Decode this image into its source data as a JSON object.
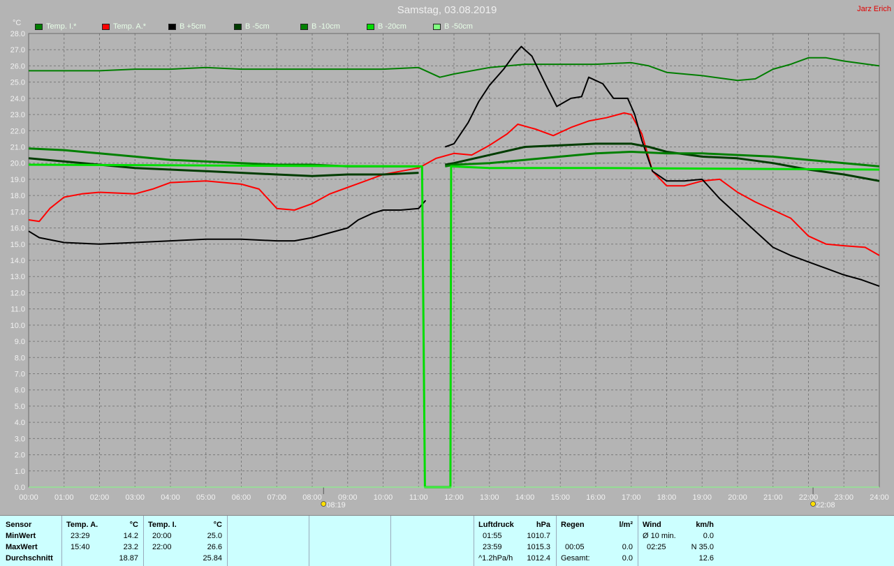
{
  "header": {
    "title": "Samstag, 03.08.2019",
    "author": "Jarz Erich"
  },
  "chart_data": {
    "type": "line",
    "ylabel": "°C",
    "ylim": [
      0,
      28
    ],
    "yticks": [
      "0.0",
      "1.0",
      "2.0",
      "3.0",
      "4.0",
      "5.0",
      "6.0",
      "7.0",
      "8.0",
      "9.0",
      "10.0",
      "11.0",
      "12.0",
      "13.0",
      "14.0",
      "15.0",
      "16.0",
      "17.0",
      "18.0",
      "19.0",
      "20.0",
      "21.0",
      "22.0",
      "23.0",
      "24.0",
      "25.0",
      "26.0",
      "27.0",
      "28.0"
    ],
    "xlim": [
      0,
      24
    ],
    "xticks": [
      "00:00",
      "01:00",
      "02:00",
      "03:00",
      "04:00",
      "05:00",
      "06:00",
      "07:00",
      "08:00",
      "09:00",
      "10:00",
      "11:00",
      "12:00",
      "13:00",
      "14:00",
      "15:00",
      "16:00",
      "17:00",
      "18:00",
      "19:00",
      "20:00",
      "21:00",
      "22:00",
      "23:00",
      "24:00"
    ],
    "annotations": [
      {
        "x": 8.32,
        "label": "08:19",
        "icon": "sunrise-icon"
      },
      {
        "x": 22.13,
        "label": "22:08",
        "icon": "sunset-icon"
      }
    ],
    "grid": true,
    "legend": "top",
    "series": [
      {
        "name": "Temp. I.*",
        "color": "#007d00",
        "width": 2,
        "points": [
          [
            0,
            25.7
          ],
          [
            1,
            25.7
          ],
          [
            2,
            25.7
          ],
          [
            3,
            25.8
          ],
          [
            4,
            25.8
          ],
          [
            5,
            25.9
          ],
          [
            6,
            25.8
          ],
          [
            7,
            25.8
          ],
          [
            8,
            25.8
          ],
          [
            9,
            25.8
          ],
          [
            10,
            25.8
          ],
          [
            11,
            25.9
          ],
          [
            11.6,
            25.3
          ],
          [
            12,
            25.5
          ],
          [
            13,
            25.9
          ],
          [
            14,
            26.1
          ],
          [
            15,
            26.1
          ],
          [
            16,
            26.1
          ],
          [
            17,
            26.2
          ],
          [
            17.5,
            26.0
          ],
          [
            18,
            25.6
          ],
          [
            19,
            25.4
          ],
          [
            20,
            25.1
          ],
          [
            20.5,
            25.2
          ],
          [
            21,
            25.8
          ],
          [
            21.5,
            26.1
          ],
          [
            22,
            26.5
          ],
          [
            22.5,
            26.5
          ],
          [
            23,
            26.3
          ],
          [
            24,
            26.0
          ]
        ]
      },
      {
        "name": "Temp. A.*",
        "color": "#ff0000",
        "width": 2,
        "points": [
          [
            0,
            16.5
          ],
          [
            0.3,
            16.4
          ],
          [
            0.6,
            17.2
          ],
          [
            1,
            17.9
          ],
          [
            1.5,
            18.1
          ],
          [
            2,
            18.2
          ],
          [
            3,
            18.1
          ],
          [
            3.5,
            18.4
          ],
          [
            4,
            18.8
          ],
          [
            5,
            18.9
          ],
          [
            6,
            18.7
          ],
          [
            6.5,
            18.4
          ],
          [
            7,
            17.2
          ],
          [
            7.5,
            17.1
          ],
          [
            8,
            17.5
          ],
          [
            8.5,
            18.1
          ],
          [
            9,
            18.5
          ],
          [
            9.5,
            18.9
          ],
          [
            10,
            19.3
          ],
          [
            10.5,
            19.5
          ],
          [
            11,
            19.7
          ],
          [
            11.5,
            20.3
          ],
          [
            12,
            20.6
          ],
          [
            12.5,
            20.5
          ],
          [
            13,
            21.1
          ],
          [
            13.5,
            21.8
          ],
          [
            13.8,
            22.4
          ],
          [
            14.3,
            22.1
          ],
          [
            14.8,
            21.7
          ],
          [
            15.3,
            22.2
          ],
          [
            15.8,
            22.6
          ],
          [
            16.3,
            22.8
          ],
          [
            16.8,
            23.1
          ],
          [
            17,
            23.0
          ],
          [
            17.3,
            21.8
          ],
          [
            17.6,
            19.5
          ],
          [
            18,
            18.6
          ],
          [
            18.5,
            18.6
          ],
          [
            19,
            18.9
          ],
          [
            19.5,
            19.0
          ],
          [
            20,
            18.2
          ],
          [
            20.5,
            17.6
          ],
          [
            21,
            17.1
          ],
          [
            21.5,
            16.6
          ],
          [
            22,
            15.5
          ],
          [
            22.5,
            15.0
          ],
          [
            23,
            14.9
          ],
          [
            23.6,
            14.8
          ],
          [
            24,
            14.3
          ]
        ]
      },
      {
        "name": "B +5cm",
        "color": "#000000",
        "width": 2,
        "points": [
          [
            0,
            15.8
          ],
          [
            0.3,
            15.4
          ],
          [
            1,
            15.1
          ],
          [
            2,
            15.0
          ],
          [
            3,
            15.1
          ],
          [
            4,
            15.2
          ],
          [
            5,
            15.3
          ],
          [
            6,
            15.3
          ],
          [
            7,
            15.2
          ],
          [
            7.5,
            15.2
          ],
          [
            8,
            15.4
          ],
          [
            8.5,
            15.7
          ],
          [
            9,
            16.0
          ],
          [
            9.3,
            16.5
          ],
          [
            9.7,
            16.9
          ],
          [
            10,
            17.1
          ],
          [
            10.5,
            17.1
          ],
          [
            11,
            17.2
          ],
          [
            11.2,
            17.7
          ],
          [
            11.4,
            null
          ],
          [
            11.75,
            21.0
          ],
          [
            12,
            21.2
          ],
          [
            12.4,
            22.5
          ],
          [
            12.7,
            23.8
          ],
          [
            13,
            24.8
          ],
          [
            13.4,
            25.8
          ],
          [
            13.7,
            26.7
          ],
          [
            13.9,
            27.2
          ],
          [
            14.2,
            26.6
          ],
          [
            14.6,
            24.8
          ],
          [
            14.9,
            23.5
          ],
          [
            15.3,
            24.0
          ],
          [
            15.6,
            24.1
          ],
          [
            15.8,
            25.3
          ],
          [
            16.2,
            24.9
          ],
          [
            16.5,
            24.0
          ],
          [
            16.9,
            24.0
          ],
          [
            17.1,
            23.0
          ],
          [
            17.3,
            21.4
          ],
          [
            17.6,
            19.5
          ],
          [
            18,
            18.9
          ],
          [
            18.5,
            18.9
          ],
          [
            19,
            19.0
          ],
          [
            19.5,
            17.8
          ],
          [
            20,
            16.8
          ],
          [
            20.5,
            15.8
          ],
          [
            21,
            14.8
          ],
          [
            21.5,
            14.3
          ],
          [
            22,
            13.9
          ],
          [
            22.5,
            13.5
          ],
          [
            23,
            13.1
          ],
          [
            23.5,
            12.8
          ],
          [
            24,
            12.4
          ]
        ]
      },
      {
        "name": "B -5cm",
        "color": "#003c00",
        "width": 3,
        "points": [
          [
            0,
            20.3
          ],
          [
            1,
            20.1
          ],
          [
            2,
            19.9
          ],
          [
            3,
            19.7
          ],
          [
            4,
            19.6
          ],
          [
            5,
            19.5
          ],
          [
            6,
            19.4
          ],
          [
            7,
            19.3
          ],
          [
            8,
            19.2
          ],
          [
            9,
            19.3
          ],
          [
            10,
            19.3
          ],
          [
            11,
            19.4
          ],
          [
            11.4,
            null
          ],
          [
            11.75,
            19.9
          ],
          [
            12,
            20.0
          ],
          [
            13,
            20.5
          ],
          [
            14,
            21.0
          ],
          [
            15,
            21.1
          ],
          [
            16,
            21.2
          ],
          [
            17,
            21.2
          ],
          [
            17.5,
            21.0
          ],
          [
            18,
            20.7
          ],
          [
            19,
            20.4
          ],
          [
            20,
            20.3
          ],
          [
            21,
            20.0
          ],
          [
            21.5,
            19.8
          ],
          [
            22,
            19.6
          ],
          [
            23,
            19.3
          ],
          [
            24,
            18.9
          ]
        ]
      },
      {
        "name": "B -10cm",
        "color": "#008000",
        "width": 3,
        "points": [
          [
            0,
            20.9
          ],
          [
            1,
            20.8
          ],
          [
            2,
            20.6
          ],
          [
            3,
            20.4
          ],
          [
            4,
            20.2
          ],
          [
            5,
            20.1
          ],
          [
            6,
            20.0
          ],
          [
            7,
            19.9
          ],
          [
            8,
            19.9
          ],
          [
            9,
            19.8
          ],
          [
            10,
            19.8
          ],
          [
            11,
            19.8
          ],
          [
            11.4,
            null
          ],
          [
            11.75,
            19.8
          ],
          [
            12,
            19.9
          ],
          [
            13,
            20.0
          ],
          [
            14,
            20.2
          ],
          [
            15,
            20.4
          ],
          [
            16,
            20.6
          ],
          [
            17,
            20.7
          ],
          [
            18,
            20.6
          ],
          [
            19,
            20.6
          ],
          [
            20,
            20.5
          ],
          [
            21,
            20.4
          ],
          [
            22,
            20.2
          ],
          [
            23,
            20.0
          ],
          [
            24,
            19.8
          ]
        ]
      },
      {
        "name": "B -20cm",
        "color": "#00dd00",
        "width": 3,
        "points": [
          [
            0,
            19.9
          ],
          [
            11,
            19.8
          ],
          [
            11.1,
            19.8
          ],
          [
            11.18,
            0.0
          ],
          [
            11.9,
            0.0
          ],
          [
            11.92,
            19.8
          ],
          [
            13,
            19.7
          ],
          [
            16,
            19.7
          ],
          [
            24,
            19.6
          ]
        ]
      },
      {
        "name": "B -50cm",
        "color": "#80ff80",
        "width": 1,
        "points": [
          [
            0,
            0.0
          ],
          [
            24,
            0.0
          ]
        ]
      }
    ]
  },
  "footer": {
    "sensor": {
      "label": "Sensor",
      "rows": [
        "MinWert",
        "MaxWert",
        "Durchschnitt"
      ]
    },
    "temp_a": {
      "label": "Temp. A.",
      "unit": "°C",
      "rows": [
        [
          "23:29",
          "14.2"
        ],
        [
          "15:40",
          "23.2"
        ],
        [
          "",
          "18.87"
        ]
      ]
    },
    "temp_i": {
      "label": "Temp. I.",
      "unit": "°C",
      "rows": [
        [
          "20:00",
          "25.0"
        ],
        [
          "22:00",
          "26.6"
        ],
        [
          "",
          "25.84"
        ]
      ]
    },
    "pressure": {
      "label": "Luftdruck",
      "unit": "hPa",
      "rows": [
        [
          "01:55",
          "1010.7"
        ],
        [
          "23:59",
          "1015.3"
        ],
        [
          "^1.2hPa/h",
          "1012.4"
        ]
      ]
    },
    "rain": {
      "label": "Regen",
      "unit": "l/m²",
      "rows": [
        [
          "",
          ""
        ],
        [
          "00:05",
          "0.0"
        ],
        [
          "Gesamt:",
          "0.0"
        ]
      ]
    },
    "wind": {
      "label": "Wind",
      "unit": "km/h",
      "rows": [
        [
          "Ø 10 min.",
          "0.0"
        ],
        [
          "02:25",
          "N 35.0"
        ],
        [
          "",
          "12.6"
        ]
      ]
    }
  }
}
